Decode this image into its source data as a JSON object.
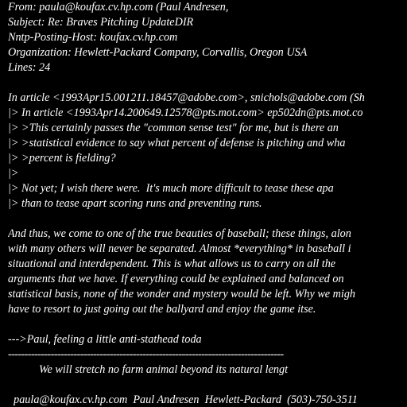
{
  "colors": {
    "background": "#000000",
    "text": "#ffffff"
  },
  "header": {
    "from": "From: paula@koufax.cv.hp.com (Paul Andresen,",
    "subject": "Subject: Re: Braves Pitching UpdateDIR",
    "nntp_host": "Nntp-Posting-Host: koufax.cv.hp.com",
    "organization": "Organization: Hewlett-Packard Company, Corvallis, Oregon USA",
    "lines": "Lines: 24"
  },
  "quoted": {
    "attribution_1": "In article <1993Apr15.001211.18457@adobe.com>, snichols@adobe.com (Sh",
    "attribution_2": "|> In article <1993Apr14.200649.12578@pts.mot.com> ep502dn@pts.mot.co",
    "q1": "|> >This certainly passes the \"common sense test\" for me, but is there an",
    "q2": "|> >statistical evidence to say what percent of defense is pitching and wha",
    "q3": "|> >percent is fielding?",
    "q4": "|>",
    "q5": "|> Not yet; I wish there were.  It's much more difficult to tease these apa",
    "q6": "|> than to tease apart scoring runs and preventing runs."
  },
  "body": {
    "p1": "And thus, we come to one of the true beauties of baseball; these things, alon",
    "p2": "with many others will never be separated. Almost *everything* in baseball i",
    "p3": "situational and interdependent. This is what allows us to carry on all the",
    "p4": "arguments that we have. If everything could be explained and balanced on",
    "p5": "statistical basis, none of the wonder and mystery would be left. Why we migh",
    "p6": "have to resort to just going out the ballyard and enjoy the game itse."
  },
  "signature": {
    "sign_off": "--->Paul, feeling a little anti-stathead toda",
    "rule": "------------------------------------------------------------------------------------",
    "motto": "           We will stretch no farm animal beyond its natural lengt",
    "contact": "  paula@koufax.cv.hp.com  Paul Andresen  Hewlett-Packard  (503)-750-3511"
  }
}
